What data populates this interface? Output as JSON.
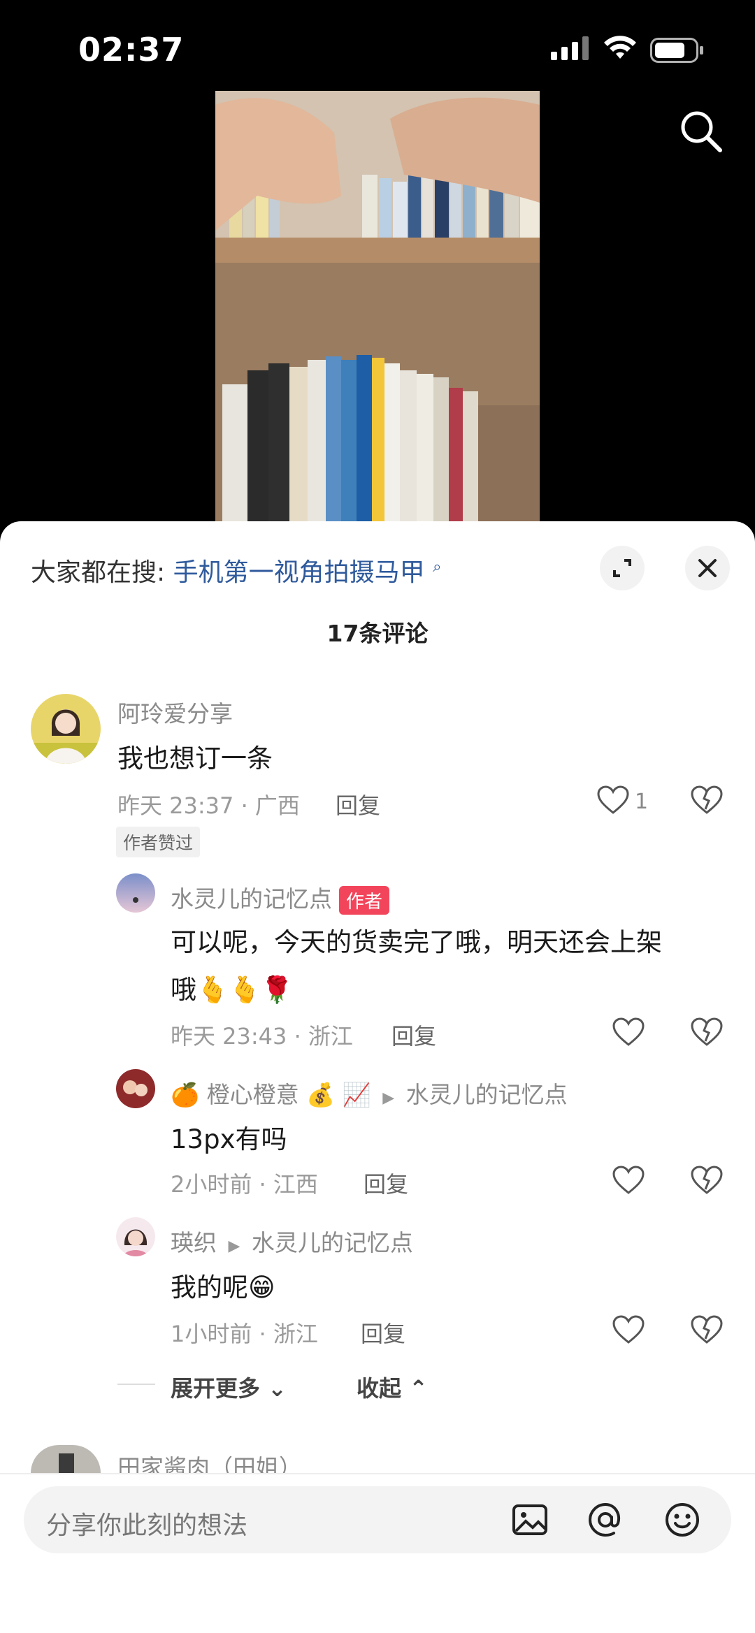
{
  "status_bar": {
    "time": "02:37"
  },
  "hot_search": {
    "prefix": "大家都在搜:",
    "keyword": "手机第一视角拍摄马甲"
  },
  "comment_count": "17条评论",
  "comments": [
    {
      "user": "阿玲爱分享",
      "text": "我也想订一条",
      "time_location": "昨天 23:37 · 广西",
      "reply_label": "回复",
      "likes": "1",
      "tag": "作者赞过"
    }
  ],
  "replies": [
    {
      "user": "水灵儿的记忆点",
      "author_badge": "作者",
      "text_line1": "可以呢，今天的货卖完了哦，明天还会上架",
      "text_line2": "哦🫰🫰🌹",
      "time_location": "昨天 23:43 · 浙江",
      "reply_label": "回复"
    },
    {
      "user": "🍊 橙心橙意 💰 📈",
      "reply_to": "水灵儿的记忆点",
      "text": "13px有吗",
      "time_location": "2小时前 · 江西",
      "reply_label": "回复"
    },
    {
      "user": "瑛织",
      "reply_to": "水灵儿的记忆点",
      "text": "我的呢😁",
      "time_location": "1小时前 · 浙江",
      "reply_label": "回复"
    }
  ],
  "expand_more": "展开更多",
  "collapse": "收起",
  "next_comment_user": "田家酱肉（田姐）",
  "input": {
    "placeholder": "分享你此刻的想法"
  },
  "colors": {
    "keyword": "#2f5a9c",
    "author_badge": "#f2455b"
  },
  "icons": [
    "search-icon",
    "expand-icon",
    "close-icon",
    "heart-icon",
    "dislike-icon",
    "image-icon",
    "at-icon",
    "emoji-icon"
  ]
}
